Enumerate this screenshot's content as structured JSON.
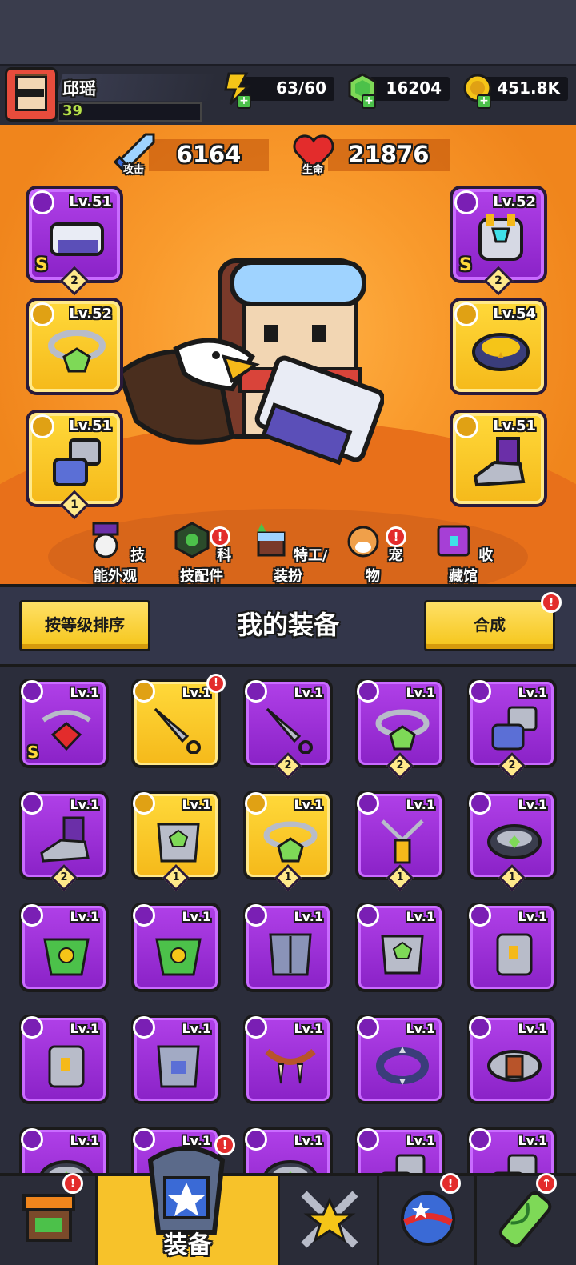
{
  "player": {
    "name": "邱瑶",
    "level": "39"
  },
  "resources": {
    "energy": "63/60",
    "gems": "16204",
    "coins": "451.8K"
  },
  "stats": {
    "attack_label": "攻击",
    "attack": "6164",
    "hp_label": "生命",
    "hp": "21876"
  },
  "equipped": [
    {
      "slot": "weapon",
      "level": "Lv.51",
      "grade": "S",
      "count": "2",
      "color": "purple"
    },
    {
      "slot": "necklace",
      "level": "Lv.52",
      "grade": "",
      "count": "",
      "color": "yellow"
    },
    {
      "slot": "gloves",
      "level": "Lv.51",
      "grade": "",
      "count": "1",
      "color": "yellow"
    },
    {
      "slot": "armor",
      "level": "Lv.52",
      "grade": "S",
      "count": "2",
      "color": "purple"
    },
    {
      "slot": "belt",
      "level": "Lv.54",
      "grade": "",
      "count": "",
      "color": "yellow"
    },
    {
      "slot": "boots",
      "level": "Lv.51",
      "grade": "",
      "count": "",
      "color": "yellow"
    }
  ],
  "menu": [
    {
      "label": "技能外观",
      "alert": false
    },
    {
      "label": "科技配件",
      "alert": true
    },
    {
      "label": "特工/装扮",
      "alert": false
    },
    {
      "label": "宠物",
      "alert": true
    },
    {
      "label": "收藏馆",
      "alert": false
    }
  ],
  "inventory": {
    "title": "我的装备",
    "sort_label": "按等级排序",
    "merge_label": "合成",
    "merge_alert": "!",
    "items": [
      {
        "level": "Lv.1",
        "color": "purple",
        "grade": "S",
        "count": "",
        "icon": "chain-necklace-icon"
      },
      {
        "level": "Lv.1",
        "color": "yellow",
        "grade": "",
        "count": "",
        "icon": "kunai-icon",
        "alert": "!"
      },
      {
        "level": "Lv.1",
        "color": "purple",
        "grade": "",
        "count": "2",
        "icon": "kunai-icon"
      },
      {
        "level": "Lv.1",
        "color": "purple",
        "grade": "",
        "count": "2",
        "icon": "gem-ring-icon"
      },
      {
        "level": "Lv.1",
        "color": "purple",
        "grade": "",
        "count": "2",
        "icon": "gauntlet-icon"
      },
      {
        "level": "Lv.1",
        "color": "purple",
        "grade": "",
        "count": "2",
        "icon": "boot-icon"
      },
      {
        "level": "Lv.1",
        "color": "yellow",
        "grade": "",
        "count": "1",
        "icon": "chest-armor-icon"
      },
      {
        "level": "Lv.1",
        "color": "yellow",
        "grade": "",
        "count": "1",
        "icon": "gem-ring-icon"
      },
      {
        "level": "Lv.1",
        "color": "purple",
        "grade": "",
        "count": "1",
        "icon": "dogtag-necklace-icon"
      },
      {
        "level": "Lv.1",
        "color": "purple",
        "grade": "",
        "count": "1",
        "icon": "belt-icon"
      },
      {
        "level": "Lv.1",
        "color": "purple",
        "grade": "",
        "count": "",
        "icon": "dragon-armor-icon"
      },
      {
        "level": "Lv.1",
        "color": "purple",
        "grade": "",
        "count": "",
        "icon": "dragon-armor-icon"
      },
      {
        "level": "Lv.1",
        "color": "purple",
        "grade": "",
        "count": "",
        "icon": "plate-armor-icon"
      },
      {
        "level": "Lv.1",
        "color": "purple",
        "grade": "",
        "count": "",
        "icon": "chest-armor-icon"
      },
      {
        "level": "Lv.1",
        "color": "purple",
        "grade": "",
        "count": "",
        "icon": "vest-armor-icon"
      },
      {
        "level": "Lv.1",
        "color": "purple",
        "grade": "",
        "count": "",
        "icon": "vest-armor-icon"
      },
      {
        "level": "Lv.1",
        "color": "purple",
        "grade": "",
        "count": "",
        "icon": "mesh-armor-icon"
      },
      {
        "level": "Lv.1",
        "color": "purple",
        "grade": "",
        "count": "",
        "icon": "fang-necklace-icon"
      },
      {
        "level": "Lv.1",
        "color": "purple",
        "grade": "",
        "count": "",
        "icon": "spiked-collar-icon"
      },
      {
        "level": "Lv.1",
        "color": "purple",
        "grade": "",
        "count": "",
        "icon": "leather-belt-icon"
      },
      {
        "level": "Lv.1",
        "color": "purple",
        "grade": "",
        "count": "",
        "icon": "belt-icon"
      },
      {
        "level": "Lv.1",
        "color": "purple",
        "grade": "",
        "count": "",
        "icon": "belt-icon"
      },
      {
        "level": "Lv.1",
        "color": "purple",
        "grade": "",
        "count": "",
        "icon": "belt-icon"
      },
      {
        "level": "Lv.1",
        "color": "purple",
        "grade": "",
        "count": "",
        "icon": "gauntlet-icon"
      },
      {
        "level": "Lv.1",
        "color": "purple",
        "grade": "",
        "count": "",
        "icon": "gauntlet-icon"
      }
    ]
  },
  "nav": [
    {
      "name": "shop",
      "label": "",
      "alert": "!"
    },
    {
      "name": "equipment",
      "label": "装备",
      "alert": "!"
    },
    {
      "name": "battle",
      "label": "",
      "alert": ""
    },
    {
      "name": "events",
      "label": "",
      "alert": "!"
    },
    {
      "name": "evolution",
      "label": "",
      "alert": "↑"
    }
  ],
  "colors": {
    "purple": "#9a2fd6",
    "yellow": "#f7c22a",
    "panel": "#2b2d3b",
    "accent": "#f0851c"
  }
}
